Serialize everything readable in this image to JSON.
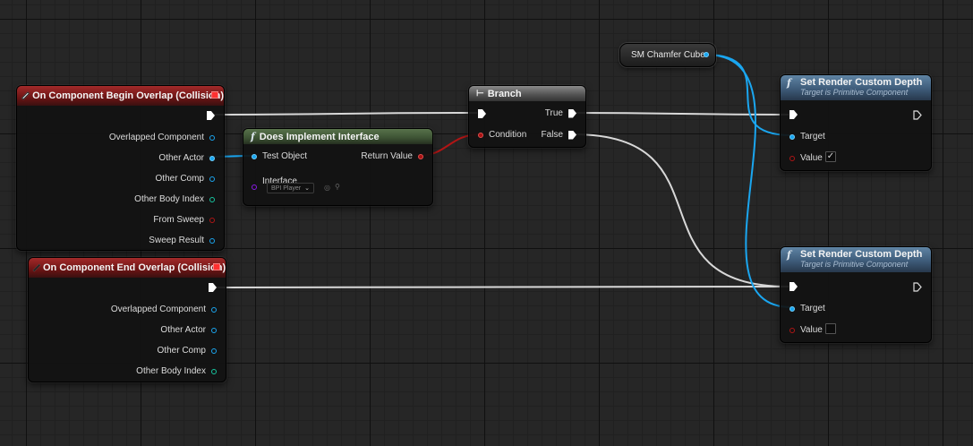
{
  "nodes": {
    "begin_overlap": {
      "title": "On Component Begin Overlap (Collision)",
      "pins": [
        "Overlapped Component",
        "Other Actor",
        "Other Comp",
        "Other Body Index",
        "From Sweep",
        "Sweep Result"
      ]
    },
    "end_overlap": {
      "title": "On Component End Overlap (Collision)",
      "pins": [
        "Overlapped Component",
        "Other Actor",
        "Other Comp",
        "Other Body Index"
      ]
    },
    "does_implement": {
      "title": "Does Implement Interface",
      "test_object": "Test Object",
      "return_value": "Return Value",
      "interface_label": "Interface",
      "interface_value": "BPI Player"
    },
    "branch": {
      "title": "Branch",
      "condition": "Condition",
      "true_label": "True",
      "false_label": "False"
    },
    "sm_var": {
      "label": "SM Chamfer Cube"
    },
    "set_depth_1": {
      "title": "Set Render Custom Depth",
      "subtitle": "Target is Primitive Component",
      "target": "Target",
      "value_label": "Value",
      "value_checked": true
    },
    "set_depth_2": {
      "title": "Set Render Custom Depth",
      "subtitle": "Target is Primitive Component",
      "target": "Target",
      "value_label": "Value",
      "value_checked": false
    }
  },
  "colors": {
    "event_header": "#a32a2a",
    "function_header_green": "#58724b",
    "function_header_blue": "#5f84a4",
    "object_pin": "#1aa6f0",
    "bool_pin": "#b01515",
    "int_pin": "#17c6a0",
    "interface_pin": "#8a1ae6",
    "exec_wire": "#e6e6e6",
    "object_wire": "#1aa6f0",
    "bool_wire": "#b01515"
  }
}
